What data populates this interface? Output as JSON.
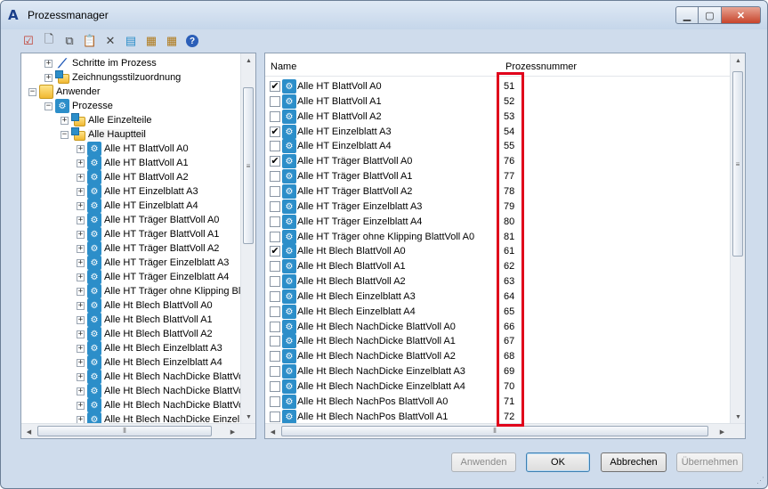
{
  "window": {
    "title": "Prozessmanager"
  },
  "toolbar": {
    "icons": [
      "properties-icon",
      "new-icon",
      "copy-icon",
      "paste-icon",
      "delete-icon",
      "move-icon",
      "import-icon",
      "export-icon",
      "help-icon"
    ]
  },
  "tree": {
    "items": [
      {
        "label": "Schritte im Prozess",
        "expander": "+",
        "icon": "steps",
        "indent": 1
      },
      {
        "label": "Zeichnungsstilzuordnung",
        "expander": "+",
        "icon": "folderproc",
        "indent": 1
      },
      {
        "label": "Anwender",
        "expander": "−",
        "icon": "folder",
        "indent": 0
      },
      {
        "label": "Prozesse",
        "expander": "−",
        "icon": "proc",
        "indent": 1
      },
      {
        "label": "Alle Einzelteile",
        "expander": "+",
        "icon": "folderproc",
        "indent": 2
      },
      {
        "label": "Alle Hauptteil",
        "expander": "−",
        "icon": "folderproc",
        "indent": 2,
        "selected": true
      },
      {
        "label": "Alle HT BlattVoll A0",
        "expander": "+",
        "icon": "proc",
        "indent": 3
      },
      {
        "label": "Alle HT BlattVoll A1",
        "expander": "+",
        "icon": "proc",
        "indent": 3
      },
      {
        "label": "Alle HT BlattVoll A2",
        "expander": "+",
        "icon": "proc",
        "indent": 3
      },
      {
        "label": "Alle HT Einzelblatt A3",
        "expander": "+",
        "icon": "proc",
        "indent": 3
      },
      {
        "label": "Alle HT Einzelblatt A4",
        "expander": "+",
        "icon": "proc",
        "indent": 3
      },
      {
        "label": "Alle HT Träger BlattVoll A0",
        "expander": "+",
        "icon": "proc",
        "indent": 3
      },
      {
        "label": "Alle HT Träger BlattVoll A1",
        "expander": "+",
        "icon": "proc",
        "indent": 3
      },
      {
        "label": "Alle HT Träger BlattVoll A2",
        "expander": "+",
        "icon": "proc",
        "indent": 3
      },
      {
        "label": "Alle HT Träger Einzelblatt A3",
        "expander": "+",
        "icon": "proc",
        "indent": 3
      },
      {
        "label": "Alle HT Träger Einzelblatt A4",
        "expander": "+",
        "icon": "proc",
        "indent": 3
      },
      {
        "label": "Alle HT Träger ohne Klipping Bla",
        "expander": "+",
        "icon": "proc",
        "indent": 3
      },
      {
        "label": "Alle Ht Blech BlattVoll A0",
        "expander": "+",
        "icon": "proc",
        "indent": 3
      },
      {
        "label": "Alle Ht Blech BlattVoll A1",
        "expander": "+",
        "icon": "proc",
        "indent": 3
      },
      {
        "label": "Alle Ht Blech BlattVoll A2",
        "expander": "+",
        "icon": "proc",
        "indent": 3
      },
      {
        "label": "Alle Ht Blech Einzelblatt A3",
        "expander": "+",
        "icon": "proc",
        "indent": 3
      },
      {
        "label": "Alle Ht Blech Einzelblatt A4",
        "expander": "+",
        "icon": "proc",
        "indent": 3
      },
      {
        "label": "Alle Ht Blech NachDicke BlattVol",
        "expander": "+",
        "icon": "proc",
        "indent": 3
      },
      {
        "label": "Alle Ht Blech NachDicke BlattVol",
        "expander": "+",
        "icon": "proc",
        "indent": 3
      },
      {
        "label": "Alle Ht Blech NachDicke BlattVol",
        "expander": "+",
        "icon": "proc",
        "indent": 3
      },
      {
        "label": "Alle Ht Blech NachDicke Einzelbl",
        "expander": "+",
        "icon": "proc",
        "indent": 3
      }
    ]
  },
  "list": {
    "headers": {
      "name": "Name",
      "number": "Prozessnummer"
    },
    "rows": [
      {
        "name": "Alle HT BlattVoll A0",
        "number": "51",
        "checked": true
      },
      {
        "name": "Alle HT BlattVoll A1",
        "number": "52",
        "checked": false
      },
      {
        "name": "Alle HT BlattVoll A2",
        "number": "53",
        "checked": false
      },
      {
        "name": "Alle HT Einzelblatt A3",
        "number": "54",
        "checked": true
      },
      {
        "name": "Alle HT Einzelblatt A4",
        "number": "55",
        "checked": false
      },
      {
        "name": "Alle HT Träger BlattVoll A0",
        "number": "76",
        "checked": true
      },
      {
        "name": "Alle HT Träger BlattVoll A1",
        "number": "77",
        "checked": false
      },
      {
        "name": "Alle HT Träger BlattVoll A2",
        "number": "78",
        "checked": false
      },
      {
        "name": "Alle HT Träger Einzelblatt A3",
        "number": "79",
        "checked": false
      },
      {
        "name": "Alle HT Träger Einzelblatt A4",
        "number": "80",
        "checked": false
      },
      {
        "name": "Alle HT Träger ohne Klipping BlattVoll A0",
        "number": "81",
        "checked": false
      },
      {
        "name": "Alle Ht Blech BlattVoll A0",
        "number": "61",
        "checked": true
      },
      {
        "name": "Alle Ht Blech BlattVoll A1",
        "number": "62",
        "checked": false
      },
      {
        "name": "Alle Ht Blech BlattVoll A2",
        "number": "63",
        "checked": false
      },
      {
        "name": "Alle Ht Blech Einzelblatt A3",
        "number": "64",
        "checked": false
      },
      {
        "name": "Alle Ht Blech Einzelblatt A4",
        "number": "65",
        "checked": false
      },
      {
        "name": "Alle Ht Blech NachDicke BlattVoll A0",
        "number": "66",
        "checked": false
      },
      {
        "name": "Alle Ht Blech NachDicke BlattVoll A1",
        "number": "67",
        "checked": false
      },
      {
        "name": "Alle Ht Blech NachDicke BlattVoll A2",
        "number": "68",
        "checked": false
      },
      {
        "name": "Alle Ht Blech NachDicke Einzelblatt A3",
        "number": "69",
        "checked": false
      },
      {
        "name": "Alle Ht Blech NachDicke Einzelblatt A4",
        "number": "70",
        "checked": false
      },
      {
        "name": "Alle Ht Blech NachPos BlattVoll A0",
        "number": "71",
        "checked": false
      },
      {
        "name": "Alle Ht Blech NachPos BlattVoll A1",
        "number": "72",
        "checked": false
      }
    ]
  },
  "buttons": {
    "apply": "Anwenden",
    "ok": "OK",
    "cancel": "Abbrechen",
    "accept": "Übernehmen"
  },
  "colors": {
    "highlight": "#e0001b",
    "process_icon": "#2c8ec9"
  }
}
